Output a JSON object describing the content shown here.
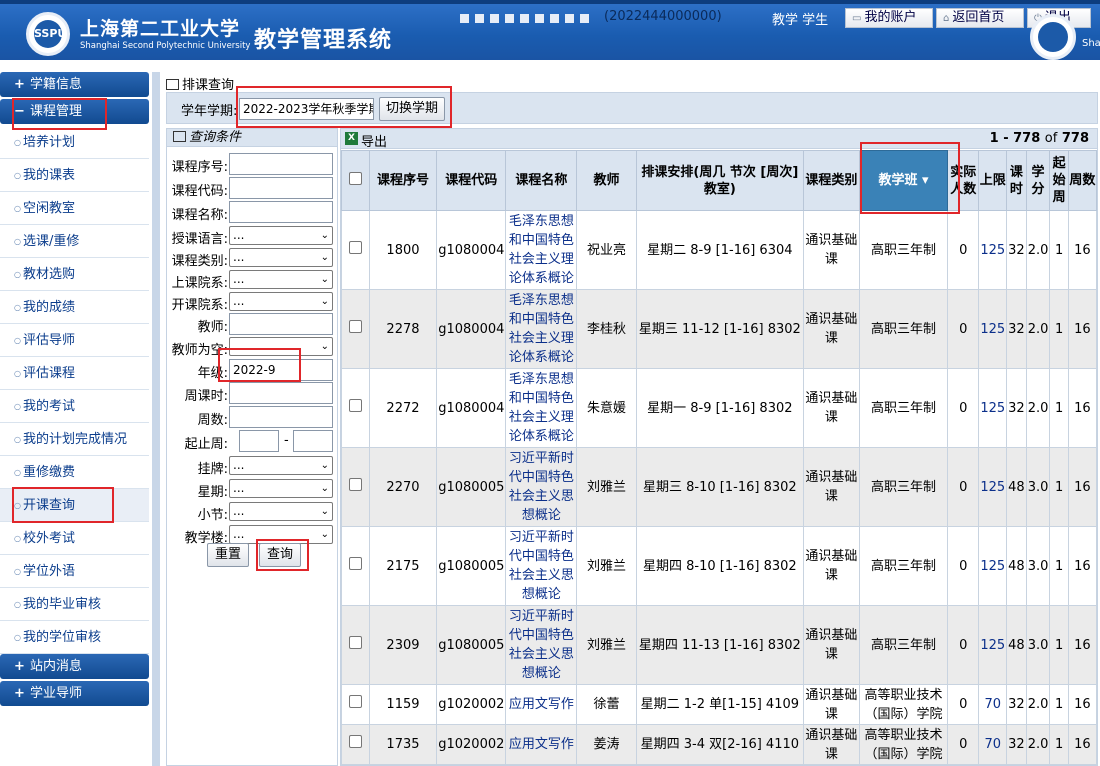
{
  "header": {
    "school_cn": "上海第二工业大学",
    "school_en": "Shanghai Second Polytechnic University",
    "system_title": "教学管理系统",
    "user_id": "(2022444000000)",
    "user_role": "教学  学生",
    "account_btn": "我的账户",
    "home_btn": "返回首页",
    "logout_btn": "退出",
    "logo_text": "SSPU",
    "sha_text": "Shar"
  },
  "sidebar": {
    "groups": [
      "学籍信息",
      "课程管理",
      "站内消息",
      "学业导师"
    ],
    "items": [
      "培养计划",
      "我的课表",
      "空闲教室",
      "选课/重修",
      "教材选购",
      "我的成绩",
      "评估导师",
      "评估课程",
      "我的考试",
      "我的计划完成情况",
      "重修缴费",
      "开课查询",
      "校外考试",
      "学位外语",
      "我的毕业审核",
      "我的学位审核"
    ]
  },
  "page": {
    "title": "排课查询",
    "term_label": "学年学期:",
    "term_value": "2022-2023学年秋季学期",
    "term_btn": "切换学期"
  },
  "query": {
    "title": "查询条件",
    "fields": [
      {
        "label": "课程序号:",
        "type": "input",
        "value": ""
      },
      {
        "label": "课程代码:",
        "type": "input",
        "value": ""
      },
      {
        "label": "课程名称:",
        "type": "input",
        "value": ""
      },
      {
        "label": "授课语言:",
        "type": "select",
        "value": "..."
      },
      {
        "label": "课程类别:",
        "type": "select",
        "value": "..."
      },
      {
        "label": "上课院系:",
        "type": "select",
        "value": "..."
      },
      {
        "label": "开课院系:",
        "type": "select",
        "value": "..."
      },
      {
        "label": "教师:",
        "type": "input",
        "value": ""
      },
      {
        "label": "教师为空:",
        "type": "select",
        "value": ""
      },
      {
        "label": "年级:",
        "type": "input",
        "value": "2022-9"
      },
      {
        "label": "周课时:",
        "type": "input",
        "value": ""
      },
      {
        "label": "周数:",
        "type": "input",
        "value": ""
      },
      {
        "label": "起止周:",
        "type": "range",
        "value": ""
      },
      {
        "label": "挂牌:",
        "type": "select",
        "value": "..."
      },
      {
        "label": "星期:",
        "type": "select",
        "value": "..."
      },
      {
        "label": "小节:",
        "type": "select",
        "value": "..."
      },
      {
        "label": "教学楼:",
        "type": "select",
        "value": "..."
      }
    ],
    "range_dash": "-",
    "reset_btn": "重置",
    "search_btn": "查询"
  },
  "results": {
    "export_label": "导出",
    "pager_range": "1 - 778",
    "pager_of": "of",
    "pager_total": "778",
    "columns": [
      "课程序号",
      "课程代码",
      "课程名称",
      "教师",
      "排课安排(周几 节次 [周次] 教室)",
      "课程类别",
      "教学班",
      "实际人数",
      "上限",
      "课时",
      "学分",
      "起始周",
      "周数"
    ],
    "rows": [
      {
        "seq": "1800",
        "code": "g1080004",
        "name": "毛泽东思想和中国特色社会主义理论体系概论",
        "teacher": "祝业亮",
        "schedule": "星期二 8-9 [1-16] 6304",
        "category": "通识基础课",
        "class": "高职三年制",
        "actual": "0",
        "limit": "125",
        "hours": "32",
        "credit": "2.0",
        "start": "1",
        "weeks": "16"
      },
      {
        "seq": "2278",
        "code": "g1080004",
        "name": "毛泽东思想和中国特色社会主义理论体系概论",
        "teacher": "李桂秋",
        "schedule": "星期三 11-12 [1-16] 8302",
        "category": "通识基础课",
        "class": "高职三年制",
        "actual": "0",
        "limit": "125",
        "hours": "32",
        "credit": "2.0",
        "start": "1",
        "weeks": "16"
      },
      {
        "seq": "2272",
        "code": "g1080004",
        "name": "毛泽东思想和中国特色社会主义理论体系概论",
        "teacher": "朱意媛",
        "schedule": "星期一 8-9 [1-16] 8302",
        "category": "通识基础课",
        "class": "高职三年制",
        "actual": "0",
        "limit": "125",
        "hours": "32",
        "credit": "2.0",
        "start": "1",
        "weeks": "16"
      },
      {
        "seq": "2270",
        "code": "g1080005",
        "name": "习近平新时代中国特色社会主义思想概论",
        "teacher": "刘雅兰",
        "schedule": "星期三 8-10 [1-16] 8302",
        "category": "通识基础课",
        "class": "高职三年制",
        "actual": "0",
        "limit": "125",
        "hours": "48",
        "credit": "3.0",
        "start": "1",
        "weeks": "16"
      },
      {
        "seq": "2175",
        "code": "g1080005",
        "name": "习近平新时代中国特色社会主义思想概论",
        "teacher": "刘雅兰",
        "schedule": "星期四 8-10 [1-16] 8302",
        "category": "通识基础课",
        "class": "高职三年制",
        "actual": "0",
        "limit": "125",
        "hours": "48",
        "credit": "3.0",
        "start": "1",
        "weeks": "16"
      },
      {
        "seq": "2309",
        "code": "g1080005",
        "name": "习近平新时代中国特色社会主义思想概论",
        "teacher": "刘雅兰",
        "schedule": "星期四 11-13 [1-16] 8302",
        "category": "通识基础课",
        "class": "高职三年制",
        "actual": "0",
        "limit": "125",
        "hours": "48",
        "credit": "3.0",
        "start": "1",
        "weeks": "16"
      },
      {
        "seq": "1159",
        "code": "g1020002",
        "name": "应用文写作",
        "teacher": "徐蕾",
        "schedule": "星期二 1-2 单[1-15] 4109",
        "category": "通识基础课",
        "class": "高等职业技术（国际）学院",
        "actual": "0",
        "limit": "70",
        "hours": "32",
        "credit": "2.0",
        "start": "1",
        "weeks": "16"
      },
      {
        "seq": "1735",
        "code": "g1020002",
        "name": "应用文写作",
        "teacher": "姜涛",
        "schedule": "星期四 3-4 双[2-16] 4110",
        "category": "通识基础课",
        "class": "高等职业技术（国际）学院",
        "actual": "0",
        "limit": "70",
        "hours": "32",
        "credit": "2.0",
        "start": "1",
        "weeks": "16"
      }
    ]
  },
  "colors": {
    "header_blue": "#1a5cb0",
    "sidebar_blue": "#114a90",
    "panel_bg": "#dae4f0",
    "sorted_col": "#3a82b7",
    "highlight": "#e0262a",
    "link": "#0b2f8a"
  }
}
